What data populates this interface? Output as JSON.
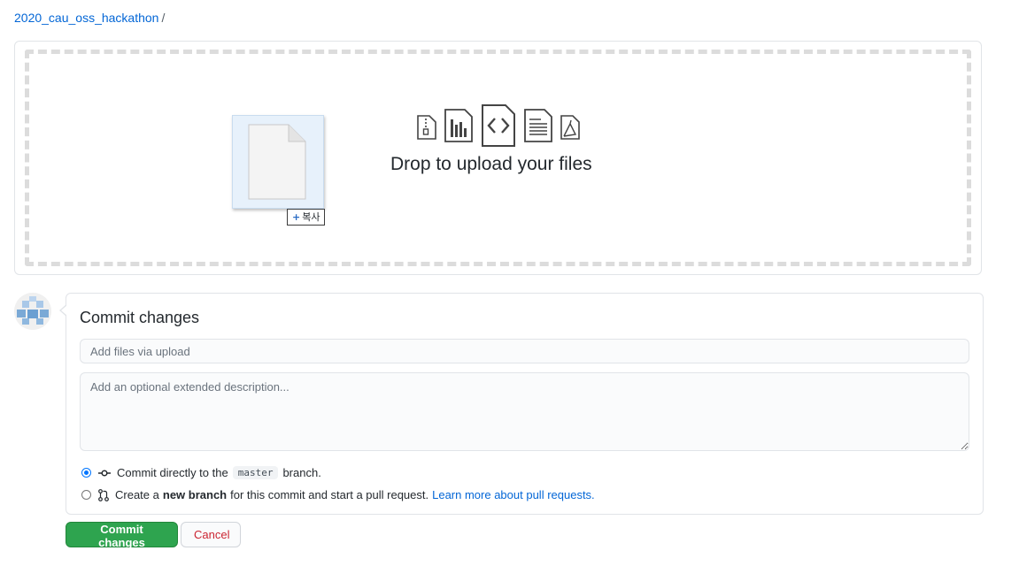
{
  "breadcrumb": {
    "repo": "2020_cau_oss_hackathon",
    "separator": "/"
  },
  "dropzone": {
    "title": "Drop to upload your files",
    "copy_badge": "복사",
    "file_icons": [
      "zip-file-icon",
      "chart-file-icon",
      "code-file-icon",
      "text-file-icon",
      "pdf-file-icon"
    ]
  },
  "commit": {
    "title": "Commit changes",
    "summary_placeholder": "Add files via upload",
    "summary_value": "",
    "description_placeholder": "Add an optional extended description...",
    "option_direct": {
      "prefix": "Commit directly to the",
      "branch": "master",
      "suffix": "branch.",
      "selected": true
    },
    "option_new": {
      "prefix": "Create a",
      "bold": "new branch",
      "suffix": "for this commit and start a pull request.",
      "link": "Learn more about pull requests.",
      "selected": false
    }
  },
  "buttons": {
    "commit": "Commit changes",
    "cancel": "Cancel"
  },
  "colors": {
    "link": "#0366d6",
    "primary": "#2ea44f",
    "danger": "#cb2431",
    "radio": "#0075ff"
  }
}
